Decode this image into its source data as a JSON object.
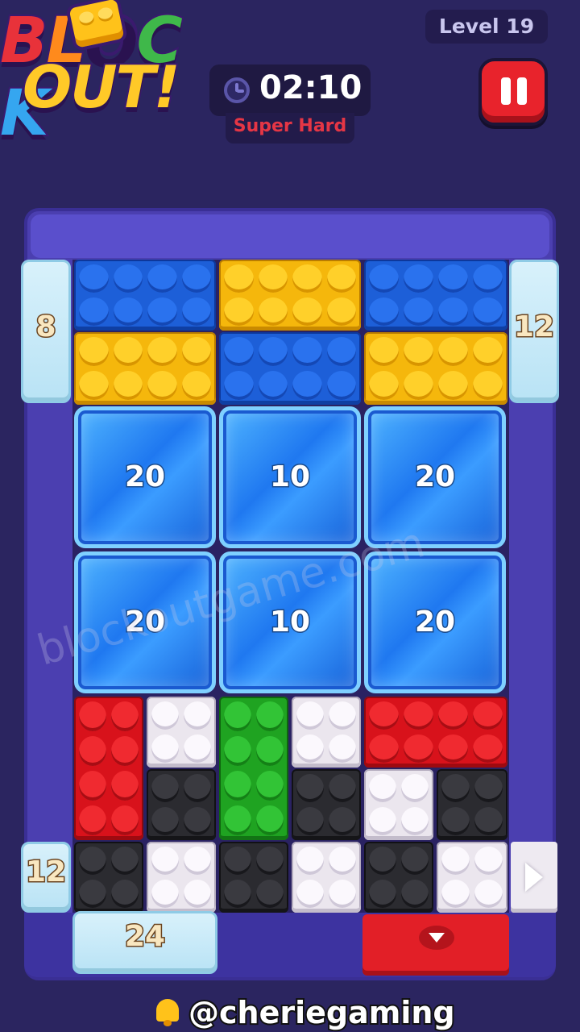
{
  "header": {
    "logo_line1": "BLOCK",
    "logo_line2": "OUT!",
    "level_label": "Level 19",
    "timer": "02:10",
    "difficulty": "Super Hard"
  },
  "colors": {
    "background": "#2b2560",
    "board": "#4b3fb0",
    "difficulty_text": "#e53645",
    "pause_button": "#e8232c"
  },
  "gates": {
    "left_top": "8",
    "right_top": "12",
    "left_bottom": "12",
    "bottom_left": "24"
  },
  "ice_blocks": [
    {
      "count": "20"
    },
    {
      "count": "10"
    },
    {
      "count": "20"
    },
    {
      "count": "20"
    },
    {
      "count": "10"
    },
    {
      "count": "20"
    }
  ],
  "bricks": [
    {
      "color": "blue"
    },
    {
      "color": "yellow"
    },
    {
      "color": "blue"
    },
    {
      "color": "yellow"
    },
    {
      "color": "blue"
    },
    {
      "color": "yellow"
    },
    {
      "color": "red"
    },
    {
      "color": "white"
    },
    {
      "color": "green"
    },
    {
      "color": "white"
    },
    {
      "color": "red"
    },
    {
      "color": "black"
    },
    {
      "color": "black"
    },
    {
      "color": "white"
    },
    {
      "color": "black"
    },
    {
      "color": "black"
    },
    {
      "color": "white"
    },
    {
      "color": "black"
    },
    {
      "color": "white"
    },
    {
      "color": "black"
    },
    {
      "color": "white"
    }
  ],
  "icons": {
    "timer": "clock-icon",
    "pause": "pause-icon",
    "exit_down": "arrow-down-icon",
    "exit_right": "arrow-right-icon",
    "credit": "bell-icon"
  },
  "watermark": "blockoutgame.com",
  "credit": "@cheriegaming"
}
